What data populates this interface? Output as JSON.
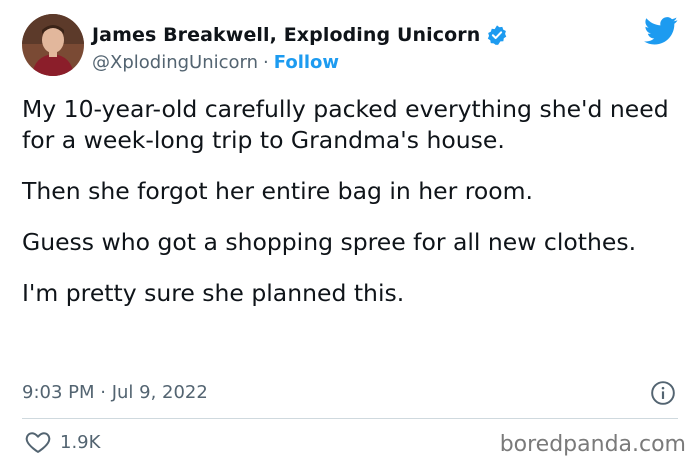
{
  "author": {
    "name": "James Breakwell, Exploding Unicorn",
    "handle": "@XplodingUnicorn",
    "separator": "·",
    "follow_label": "Follow",
    "verified": true
  },
  "tweet": {
    "paragraphs": [
      "My 10-year-old carefully packed everything she'd need for a week-long trip to Grandma's house.",
      "Then she forgot her entire bag in her room.",
      "Guess who got a shopping spree for all new clothes.",
      "I'm pretty sure she planned this."
    ],
    "timestamp": "9:03 PM · Jul 9, 2022",
    "likes": "1.9K"
  },
  "icons": {
    "platform": "twitter-bird-icon",
    "verified": "verified-badge-icon",
    "info": "info-icon",
    "like": "heart-icon"
  },
  "colors": {
    "accent": "#1d9bf0",
    "secondary_text": "#536471",
    "divider": "#cfd9de"
  },
  "watermark": "boredpanda.com"
}
